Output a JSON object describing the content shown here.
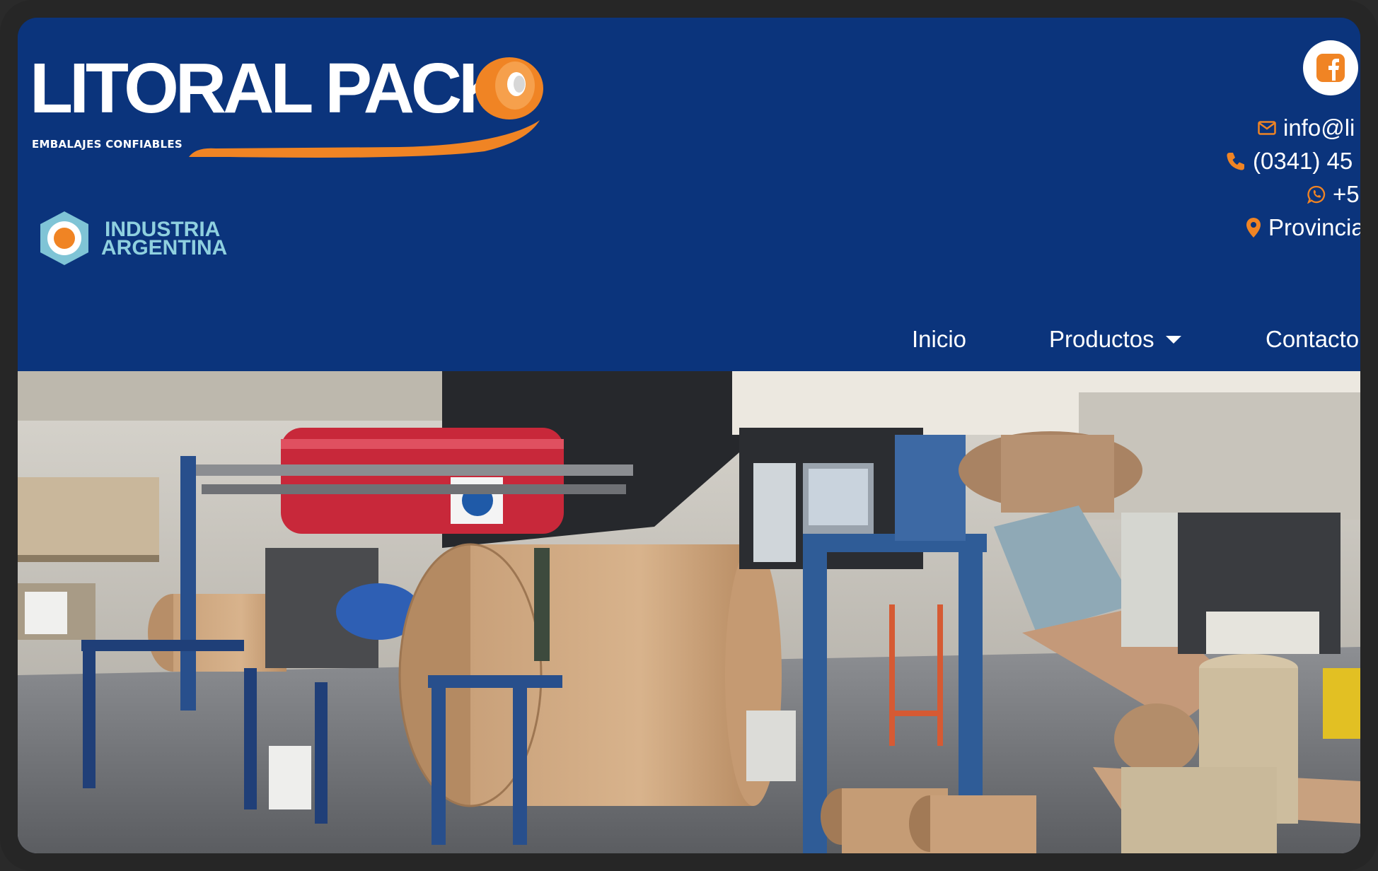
{
  "brand": {
    "name": "LITORAL PACK",
    "tagline": "EMBALAJES CONFIABLES",
    "badge_line1": "INDUSTRIA",
    "badge_line2": "ARGENTINA",
    "colors": {
      "header_bg": "#0b347c",
      "accent": "#f08424",
      "badge": "#8fd0df"
    }
  },
  "social": {
    "facebook_icon": "facebook-icon"
  },
  "contact": {
    "email": "info@li",
    "phone": "(0341) 45",
    "whatsapp": "+5",
    "address": "Provincia"
  },
  "nav": {
    "items": [
      {
        "label": "Inicio"
      },
      {
        "label": "Productos"
      },
      {
        "label": "Contacto"
      }
    ]
  },
  "hero": {
    "image": "factory-paper-rolls-photo"
  }
}
